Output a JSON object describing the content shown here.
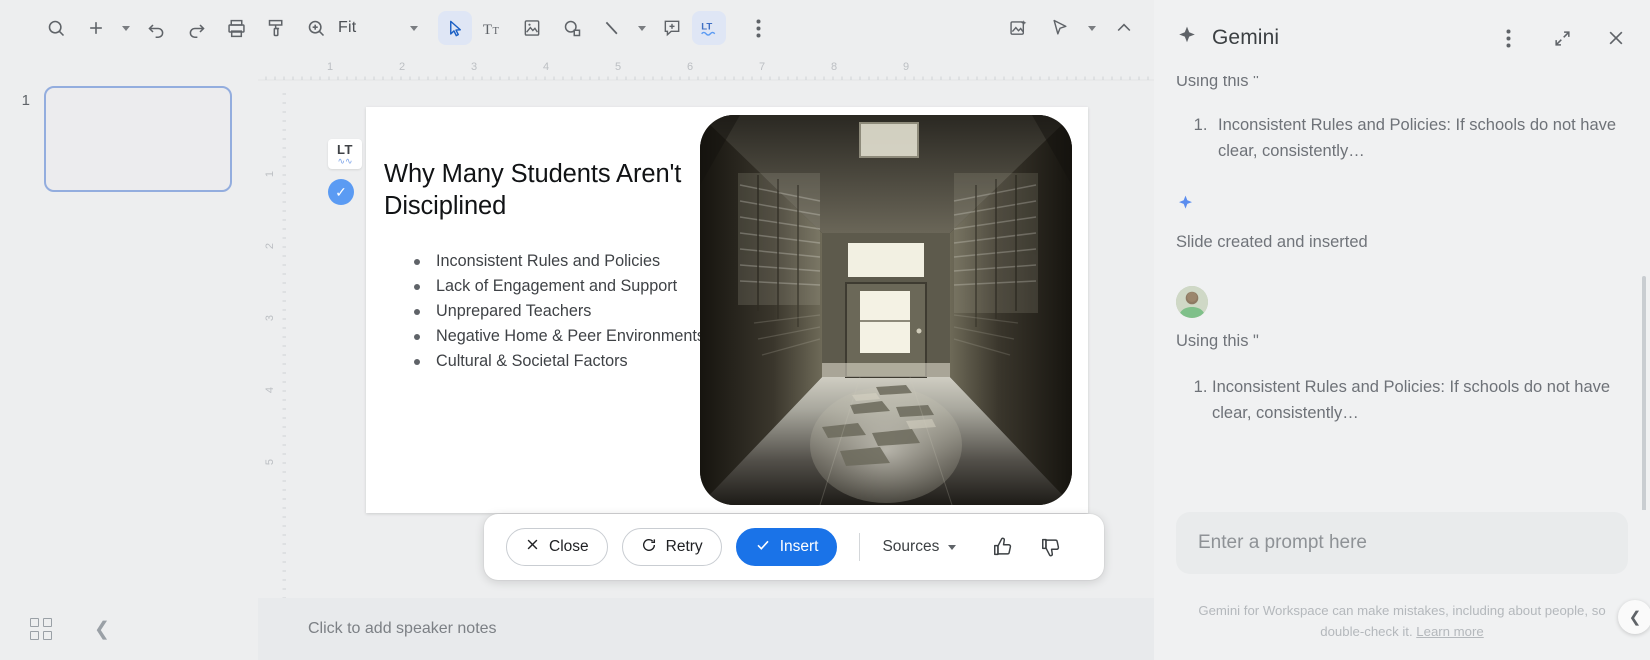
{
  "toolbar": {
    "items": [
      {
        "name": "search-icon",
        "label": "Search"
      },
      {
        "name": "add-slide-icon",
        "label": "New slide"
      },
      {
        "name": "undo-icon",
        "label": "Undo"
      },
      {
        "name": "redo-icon",
        "label": "Redo"
      },
      {
        "name": "print-icon",
        "label": "Print"
      },
      {
        "name": "paint-format-icon",
        "label": "Paint format"
      },
      {
        "name": "zoom-icon",
        "label": "Zoom"
      }
    ],
    "zoom_value": "Fit",
    "tools": [
      {
        "name": "select-tool-icon",
        "label": "Select"
      },
      {
        "name": "text-box-icon",
        "label": "Text box"
      },
      {
        "name": "insert-image-icon",
        "label": "Image"
      },
      {
        "name": "shape-icon",
        "label": "Shape"
      },
      {
        "name": "line-icon",
        "label": "Line"
      },
      {
        "name": "comment-icon",
        "label": "Comment"
      },
      {
        "name": "language-tool-icon",
        "label": "LanguageTool"
      }
    ],
    "more_label": "More",
    "right_tools": [
      {
        "name": "image-sparkle-icon",
        "label": "Create image"
      },
      {
        "name": "laser-pointer-icon",
        "label": "Laser pointer"
      },
      {
        "name": "collapse-toolbar-icon",
        "label": "Hide the menus"
      }
    ]
  },
  "filmstrip": {
    "slides": [
      {
        "number": "1"
      }
    ],
    "grid_view_label": "Grid view",
    "collapse_label": "Hide filmstrip"
  },
  "rulers": {
    "horizontal_ticks": [
      "1",
      "2",
      "3",
      "4",
      "5",
      "6",
      "7",
      "8",
      "9"
    ],
    "vertical_ticks": [
      "1",
      "2",
      "3",
      "4",
      "5"
    ]
  },
  "slide": {
    "title": "Why Many Students Aren't Disciplined",
    "bullets": [
      "Inconsistent Rules and Policies",
      "Lack of Engagement and Support",
      "Unprepared Teachers",
      "Negative Home & Peer Environments",
      "Cultural & Societal Factors"
    ],
    "image_alt": "School hallway lined with lockers and a lit door at the end",
    "lt_badge": {
      "label": "LT",
      "status": "checked"
    }
  },
  "notes": {
    "placeholder": "Click to add speaker notes"
  },
  "action_bar": {
    "close_label": "Close",
    "retry_label": "Retry",
    "insert_label": "Insert",
    "sources_label": "Sources",
    "thumbs_up_label": "Good response",
    "thumbs_down_label": "Bad response"
  },
  "gemini": {
    "title": "Gemini",
    "more_options_label": "More options",
    "expand_label": "Expand",
    "close_label": "Close",
    "message_1": {
      "prefix": "Using this \"",
      "list": [
        "Inconsistent Rules and Policies: If schools do not have clear, consistently…"
      ]
    },
    "status": "Slide created and inserted",
    "message_2": {
      "prefix": "Using this \"",
      "list": [
        "Inconsistent Rules and Policies: If schools do not have clear, consistently…"
      ]
    },
    "prompt_placeholder": "Enter a prompt here",
    "disclaimer": "Gemini for Workspace can make mistakes, including about people, so double-check it. ",
    "learn_more": "Learn more",
    "collapse_label": "Collapse panel"
  },
  "colors": {
    "accent_blue": "#1a73e8",
    "panel_bg": "#f0f1f2",
    "app_bg": "#edeeef",
    "selection_border": "#93adde"
  }
}
